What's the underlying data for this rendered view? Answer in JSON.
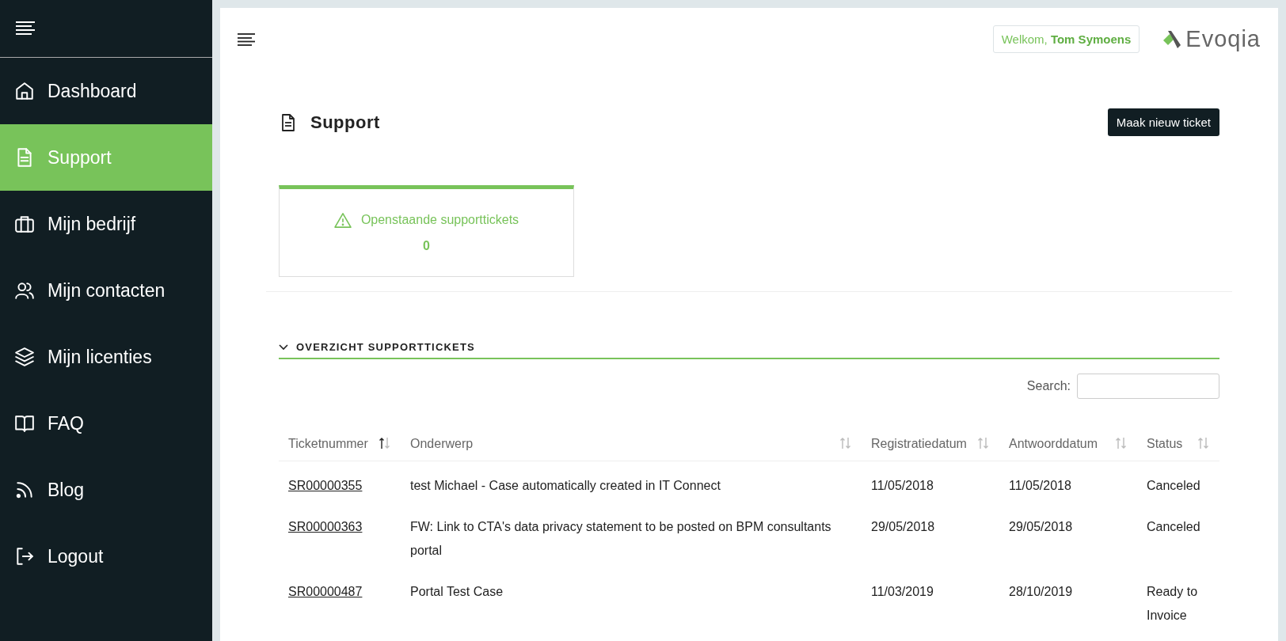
{
  "sidebar": {
    "items": [
      {
        "label": "Dashboard",
        "selected": false
      },
      {
        "label": "Support",
        "selected": true
      },
      {
        "label": "Mijn bedrijf",
        "selected": false
      },
      {
        "label": "Mijn contacten",
        "selected": false
      },
      {
        "label": "Mijn licenties",
        "selected": false
      },
      {
        "label": "FAQ",
        "selected": false
      },
      {
        "label": "Blog",
        "selected": false
      },
      {
        "label": "Logout",
        "selected": false
      }
    ]
  },
  "header": {
    "welcome": "Welkom, **Tom Symoens**",
    "logo": "Evoqia"
  },
  "page": {
    "title": "Support",
    "new_ticket_button": "Maak nieuw ticket"
  },
  "summary_card": {
    "label": "Openstaande supporttickets",
    "count": "0"
  },
  "section": {
    "title": "OVERZICHT SUPPORTTICKETS",
    "expanded": true
  },
  "search": {
    "label": "Search:"
  },
  "table": {
    "columns": [
      {
        "label": "Ticketnummer",
        "sorted": true
      },
      {
        "label": "Onderwerp",
        "sorted": false
      },
      {
        "label": "Registratiedatum",
        "sorted": false
      },
      {
        "label": "Antwoorddatum",
        "sorted": false
      },
      {
        "label": "Status",
        "sorted": false
      }
    ],
    "rows": [
      {
        "ticket": "SR00000355",
        "subject": "test Michael - Case automatically created in IT Connect",
        "registered": "11/05/2018",
        "answered": "11/05/2018",
        "status": "Canceled"
      },
      {
        "ticket": "SR00000363",
        "subject": "FW: Link to CTA's data privacy statement to be posted on BPM consultants portal",
        "registered": "29/05/2018",
        "answered": "29/05/2018",
        "status": "Canceled"
      },
      {
        "ticket": "SR00000487",
        "subject": "Portal Test Case",
        "registered": "11/03/2019",
        "answered": "28/10/2019",
        "status": "Ready to Invoice"
      }
    ]
  }
}
